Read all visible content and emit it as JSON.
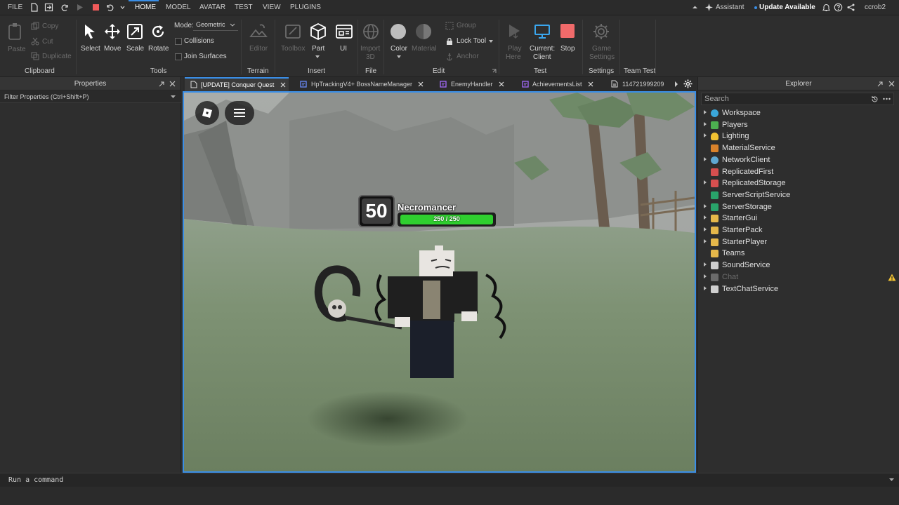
{
  "menubar": {
    "file": "FILE",
    "tabs": [
      "HOME",
      "MODEL",
      "AVATAR",
      "TEST",
      "VIEW",
      "PLUGINS"
    ],
    "assistant": "Assistant",
    "update": "Update Available",
    "username": "ccrob2"
  },
  "ribbon": {
    "clipboard": {
      "paste": "Paste",
      "copy": "Copy",
      "cut": "Cut",
      "duplicate": "Duplicate",
      "group": "Clipboard"
    },
    "tools": {
      "select": "Select",
      "move": "Move",
      "scale": "Scale",
      "rotate": "Rotate",
      "mode_label": "Mode:",
      "mode_value": "Geometric",
      "collisions": "Collisions",
      "join_surfaces": "Join Surfaces",
      "group": "Tools"
    },
    "terrain": {
      "editor": "Editor",
      "group": "Terrain"
    },
    "insert": {
      "toolbox": "Toolbox",
      "part": "Part",
      "ui": "UI",
      "group": "Insert"
    },
    "file": {
      "import": "Import",
      "import2": "3D",
      "group": "File"
    },
    "edit": {
      "color": "Color",
      "material": "Material",
      "group_btn": "Group",
      "lock_tool": "Lock Tool",
      "anchor": "Anchor",
      "group": "Edit"
    },
    "test": {
      "play": "Play",
      "play2": "Here",
      "current": "Current:",
      "current2": "Client",
      "stop": "Stop",
      "group": "Test"
    },
    "settings": {
      "game": "Game",
      "game2": "Settings",
      "group": "Settings"
    },
    "team_test": {
      "group": "Team Test"
    }
  },
  "properties": {
    "title": "Properties",
    "filter": "Filter Properties (Ctrl+Shift+P)"
  },
  "doc_tabs": [
    {
      "label": "[UPDATE] Conquer Quest"
    },
    {
      "label": "HpTrackingV4+ BossNameManager"
    },
    {
      "label": "EnemyHandler"
    },
    {
      "label": "AchievementsList"
    },
    {
      "label": "114721999209"
    }
  ],
  "game": {
    "level": "50",
    "boss_name": "Necromancer",
    "hp_text": "250 / 250",
    "hp_fraction": 1.0
  },
  "explorer": {
    "title": "Explorer",
    "search_placeholder": "Search",
    "items": [
      {
        "label": "Workspace",
        "icon": "workspace-icon",
        "color": "#3aa6d9"
      },
      {
        "label": "Players",
        "icon": "players-icon",
        "color": "#4caf50"
      },
      {
        "label": "Lighting",
        "icon": "lighting-icon",
        "color": "#f1c232"
      },
      {
        "label": "MaterialService",
        "icon": "material-service-icon",
        "color": "#d9822b"
      },
      {
        "label": "NetworkClient",
        "icon": "network-client-icon",
        "color": "#5fa8d3"
      },
      {
        "label": "ReplicatedFirst",
        "icon": "replicated-first-icon",
        "color": "#d64f4f"
      },
      {
        "label": "ReplicatedStorage",
        "icon": "replicated-storage-icon",
        "color": "#d64f4f"
      },
      {
        "label": "ServerScriptService",
        "icon": "server-script-service-icon",
        "color": "#29a36a"
      },
      {
        "label": "ServerStorage",
        "icon": "server-storage-icon",
        "color": "#29a36a"
      },
      {
        "label": "StarterGui",
        "icon": "starter-gui-icon",
        "color": "#e6b84a"
      },
      {
        "label": "StarterPack",
        "icon": "starter-pack-icon",
        "color": "#e6b84a"
      },
      {
        "label": "StarterPlayer",
        "icon": "starter-player-icon",
        "color": "#e6b84a"
      },
      {
        "label": "Teams",
        "icon": "teams-icon",
        "color": "#e6b84a"
      },
      {
        "label": "SoundService",
        "icon": "sound-service-icon",
        "color": "#cfcfcf"
      },
      {
        "label": "Chat",
        "icon": "chat-icon",
        "color": "#6b6b6b"
      },
      {
        "label": "TextChatService",
        "icon": "text-chat-service-icon",
        "color": "#cfcfcf"
      }
    ]
  },
  "command_bar": {
    "placeholder": "Run a command"
  },
  "colors": {
    "accent": "#3a8ee6",
    "stop": "#f05a5a",
    "hp_bar": "#35c635"
  }
}
